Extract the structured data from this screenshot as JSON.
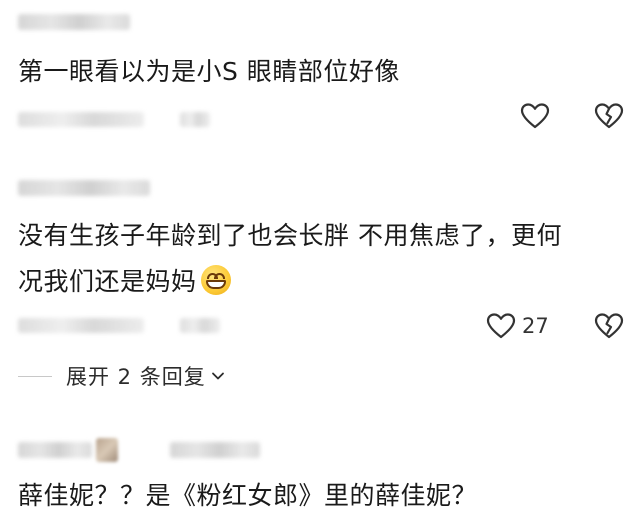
{
  "comments": [
    {
      "text": "第一眼看以为是小S  眼睛部位好像",
      "text_line2": "",
      "like_count": "",
      "has_emoji": false
    },
    {
      "text": "没有生孩子年龄到了也会长胖  不用焦虑了，更何",
      "text_line2": "况我们还是妈妈",
      "like_count": "27",
      "has_emoji": true,
      "emoji_name": "grinning-face-emoji"
    },
    {
      "text": "薛佳妮？？是《粉红女郎》里的薛佳妮？",
      "text_line2": "",
      "like_count": "",
      "has_emoji": false
    }
  ],
  "replies": {
    "expand_label": "展开 2 条回复"
  },
  "icons": {
    "like": "heart-outline-icon",
    "dislike": "broken-heart-icon",
    "expand": "chevron-down-icon"
  },
  "colors": {
    "text": "#1a1a1a",
    "icon": "#333333",
    "blur": "#d0d0d0",
    "background": "#ffffff"
  }
}
